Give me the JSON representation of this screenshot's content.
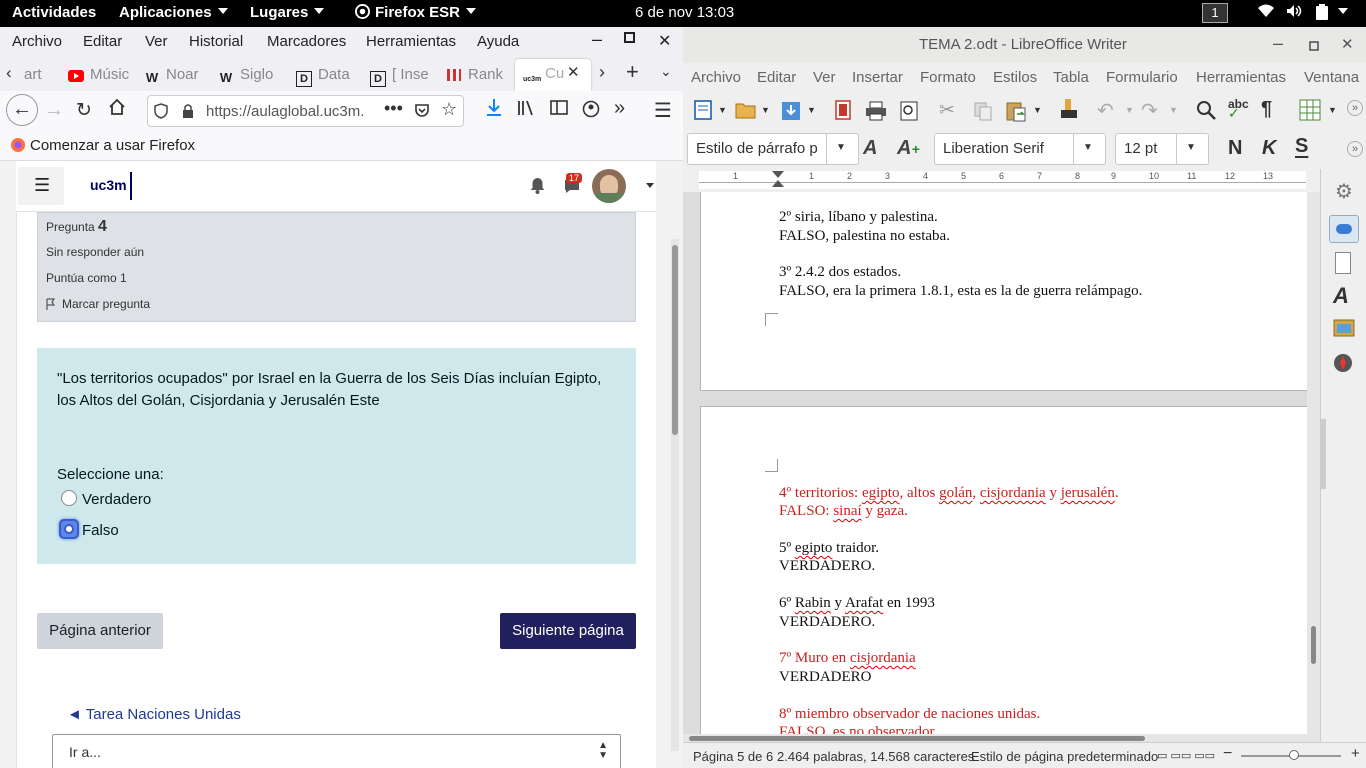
{
  "topbar": {
    "activities": "Actividades",
    "applications": "Aplicaciones",
    "places": "Lugares",
    "firefox_app": "Firefox ESR",
    "clock": "6 de nov  13:03",
    "workspace": "1"
  },
  "firefox": {
    "menu": [
      "Archivo",
      "Editar",
      "Ver",
      "Historial",
      "Marcadores",
      "Herramientas",
      "Ayuda"
    ],
    "tabs": [
      {
        "label": "art",
        "icon": "tab-favicon"
      },
      {
        "label": "Músic",
        "icon": "youtube-icon"
      },
      {
        "label": "Noar",
        "icon": "wikipedia-icon"
      },
      {
        "label": "Siglo",
        "icon": "wikipedia-icon"
      },
      {
        "label": "Data",
        "icon": "document-icon"
      },
      {
        "label": "[ Inse",
        "icon": "document-icon"
      },
      {
        "label": "Rank",
        "icon": "ranking-icon"
      },
      {
        "label": "Cu",
        "icon": "uc3m-icon"
      }
    ],
    "url": "https://aulaglobal.uc3m.",
    "bookmark": "Comenzar a usar Firefox"
  },
  "moodle": {
    "logo": "uc3m",
    "notification_count": "17",
    "question_label": "Pregunta",
    "question_number": "4",
    "status": "Sin responder aún",
    "score": "Puntúa como 1",
    "flag": "Marcar pregunta",
    "question_text": "\"Los territorios ocupados\" por Israel en la Guerra de los Seis Días incluían Egipto, los Altos del Golán, Cisjordania y Jerusalén Este",
    "prompt": "Seleccione una:",
    "option_true": "Verdadero",
    "option_false": "Falso",
    "prev_button": "Página anterior",
    "next_button": "Siguiente página",
    "back_link": "◄ Tarea Naciones Unidas",
    "jump_select": "Ir a..."
  },
  "writer": {
    "title": "TEMA 2.odt - LibreOffice Writer",
    "menu": [
      "Archivo",
      "Editar",
      "Ver",
      "Insertar",
      "Formato",
      "Estilos",
      "Tabla",
      "Formulario",
      "Herramientas",
      "Ventana"
    ],
    "paragraph_style": "Estilo de párrafo p",
    "font_name": "Liberation Serif",
    "font_size": "12 pt",
    "bold": "N",
    "italic": "K",
    "strike": "S",
    "ruler_numbers": [
      "1",
      "1",
      "2",
      "3",
      "4",
      "5",
      "6",
      "7",
      "8",
      "9",
      "10",
      "11",
      "12",
      "13"
    ],
    "doc": {
      "l1": "2º siria, líbano y palestina.",
      "l2": "FALSO, palestina no estaba.",
      "l3": "3º 2.4.2 dos estados.",
      "l4": "FALSO, era la primera 1.8.1, esta es la de guerra relámpago.",
      "l5a": "4º territorios: ",
      "l5b": "egipto",
      "l5c": ", altos ",
      "l5d": "golán",
      "l5e": ", ",
      "l5f": "cisjordania",
      "l5g": " y ",
      "l5h": "jerusalén",
      "l5i": ".",
      "l6a": "FALSO: ",
      "l6b": "sinaí",
      "l6c": " y gaza.",
      "l7a": "5º ",
      "l7b": "egipto",
      "l7c": " traidor.",
      "l8": "VERDADERO.",
      "l9a": "6º ",
      "l9b": "Rabin",
      "l9c": " y ",
      "l9d": "Arafat",
      "l9e": " en 1993",
      "l10": "VERDADERO.",
      "l11a": "7º Muro en ",
      "l11b": "cisjordania",
      "l12": "VERDADERO",
      "l13": "8º miembro observador de naciones unidas.",
      "l14": "FALSO, es no observador"
    },
    "status": {
      "page": "Página 5 de 6",
      "words": "2.464 palabras, 14.568 caracteres",
      "page_style": "Estilo de página predeterminado"
    }
  }
}
